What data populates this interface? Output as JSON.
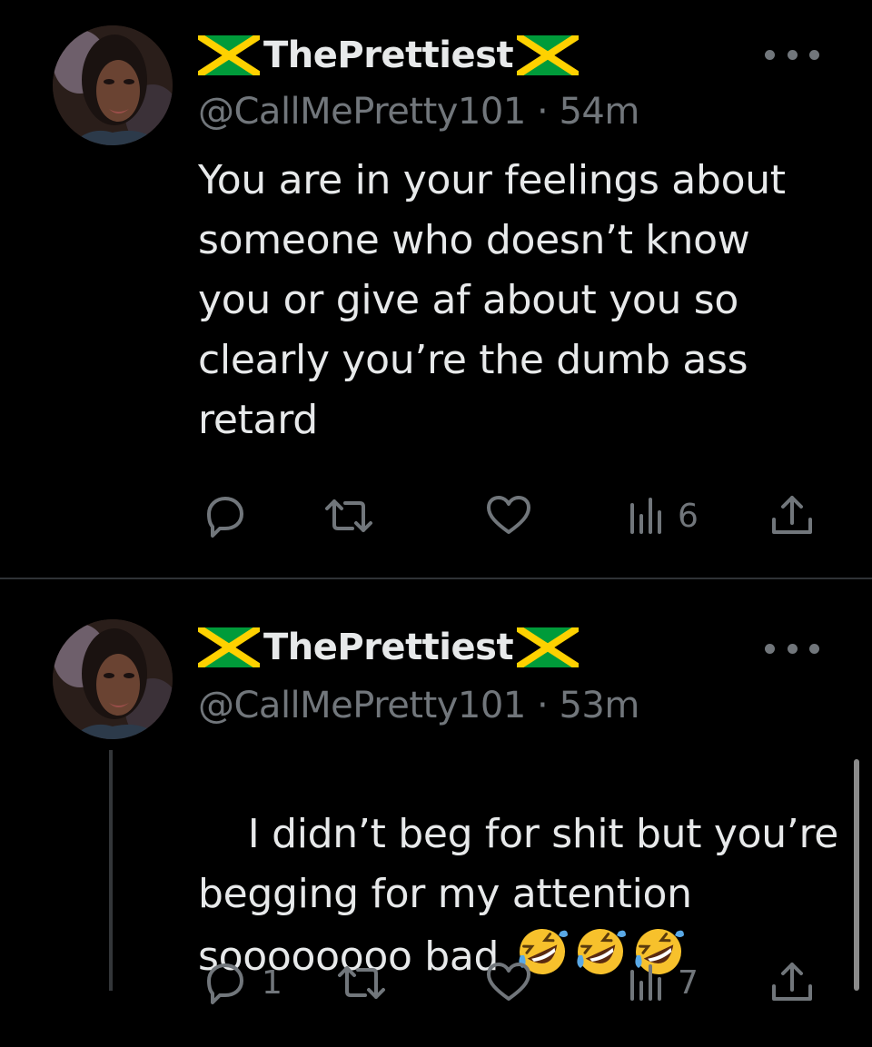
{
  "tweets": [
    {
      "display_name": "ThePrettiest",
      "handle": "@CallMePretty101",
      "separator": "·",
      "time": "54m",
      "text": "You are in your feelings about\nsomeone who doesn’t know\nyou or give af about you so\nclearly you’re the dumb ass\nretard",
      "views": "6",
      "replies": "",
      "reposts": "",
      "likes": ""
    },
    {
      "display_name": "ThePrettiest",
      "handle": "@CallMePretty101",
      "separator": "·",
      "time": "53m",
      "text": "I didn’t beg for shit but you’re\nbegging for my attention\nsoooooooo bad ",
      "emoji": [
        "rolling-on-floor-laughing",
        "rolling-on-floor-laughing",
        "rolling-on-floor-laughing"
      ],
      "replies": "1",
      "views": "7"
    }
  ],
  "colors": {
    "background": "#000000",
    "text": "#e7e9ea",
    "secondary": "#71767b",
    "divider": "#2f3336",
    "flag_green": "#009b3a",
    "flag_yellow": "#fed100",
    "flag_black": "#000000"
  },
  "icons": [
    "reply-icon",
    "repost-icon",
    "like-icon",
    "views-icon",
    "share-icon",
    "more-icon",
    "jamaica-flag-icon"
  ]
}
